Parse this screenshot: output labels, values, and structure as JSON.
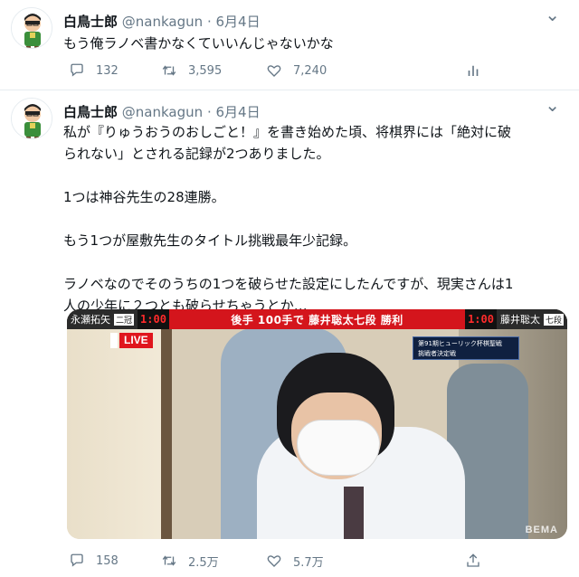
{
  "tweets": [
    {
      "name": "白鳥士郎",
      "handle": "@nankagun",
      "dot": "·",
      "date": "6月4日",
      "more": "⌄",
      "text_lines": [
        "もう俺ラノベ書かなくていいんじゃないかな"
      ],
      "actions": {
        "replies": "132",
        "retweets": "3,595",
        "likes": "7,240"
      }
    },
    {
      "name": "白鳥士郎",
      "handle": "@nankagun",
      "dot": "·",
      "date": "6月4日",
      "more": "⌄",
      "text_lines": [
        "私が『りゅうおうのおしごと！』を書き始めた頃、将棋界には「絶対に破",
        "られない」とされる記録が2つありました。",
        "",
        "1つは神谷先生の28連勝。",
        "",
        "もう1つが屋敷先生のタイトル挑戦最年少記録。",
        "",
        "ラノベなのでそのうちの1つを破らせた設定にしたんですが、現実さんは1",
        "人の少年に２つとも破らせちゃうとか…"
      ],
      "media": {
        "banner_left_name": "永瀬拓矢",
        "banner_left_rank": "二冠",
        "banner_left_clock": "1:00",
        "banner_center": "後手 100手で 藤井聡太七段 勝利",
        "banner_right_clock": "1:00",
        "banner_right_name": "藤井聡太",
        "banner_right_rank": "七段",
        "live": "LIVE",
        "info_line1": "第91期ヒューリック杯棋聖戦",
        "info_line2": "挑戦者決定戦",
        "watermark": "BEMA"
      },
      "actions": {
        "replies": "158",
        "retweets": "2.5万",
        "likes": "5.7万"
      }
    }
  ],
  "icons": [
    "reply-icon",
    "retweet-icon",
    "like-icon",
    "share-icon",
    "chevron-down-icon"
  ],
  "colors": {
    "secondary_text": "#657786",
    "divider": "#e6ecf0",
    "live_red": "#e0161d",
    "banner_red": "#d4151c"
  }
}
